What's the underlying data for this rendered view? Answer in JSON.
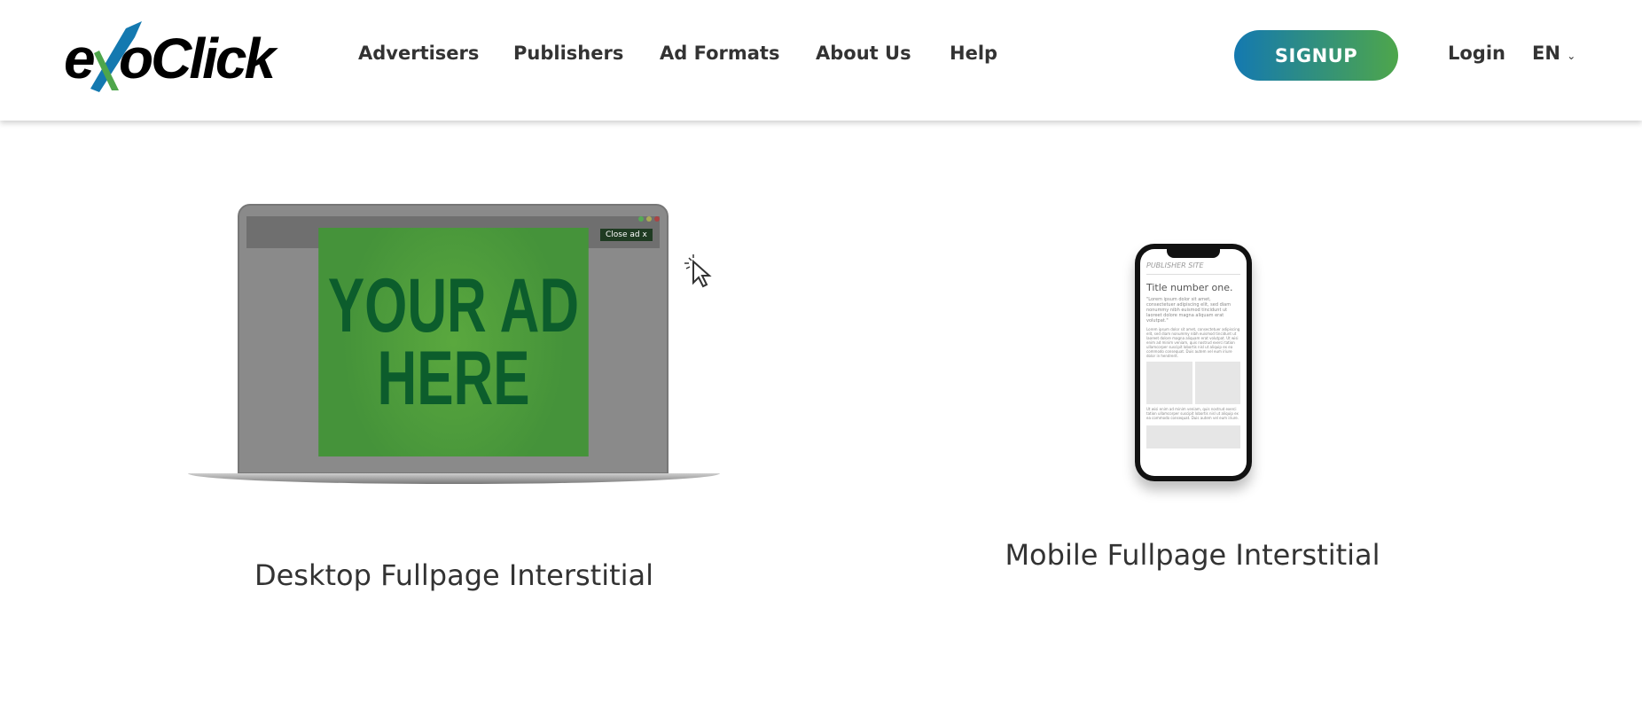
{
  "header": {
    "logo_text": "exoClick",
    "nav": [
      "Advertisers",
      "Publishers",
      "Ad Formats",
      "About Us",
      "Help"
    ],
    "signup_label": "SIGNUP",
    "login_label": "Login",
    "language": "EN"
  },
  "colors": {
    "brand_blue": "#1479b0",
    "brand_green": "#4ea64b",
    "ad_green": "#4a9a3c"
  },
  "desktop": {
    "ad_line1": "YOUR AD",
    "ad_line2": "HERE",
    "close_ad": "Close ad x",
    "label": "Desktop Fullpage Interstitial"
  },
  "mobile": {
    "site_name": "PUBLISHER SITE",
    "title": "Title number one.",
    "quote": "\"Lorem ipsum dolor sit amet, consectetuer adipiscing elit, sed diam nonummy nibh euismod tincidunt ut laoreet dolore magna aliquam erat volutpat.\"",
    "body1": "Lorem ipsum dolor sit amet, consectetuer adipiscing elit, sed diam nonummy nibh euismod tincidunt ut laoreet dolore magna aliquam erat volutpat. Ut wisi enim ad minim veniam, quis nostrud exerci tation ullamcorper suscipit lobortis nisl ut aliquip ex ea commodo consequat. Duis autem vel eum iriure dolor in hendrerit.",
    "body2": "Ut wisi enim ad minim veniam, quis nostrud exerci tation ullamcorper suscipit lobortis nisl ut aliquip ex ea commodo consequat. Duis autem vel eum iriure.",
    "label": "Mobile Fullpage Interstitial"
  }
}
